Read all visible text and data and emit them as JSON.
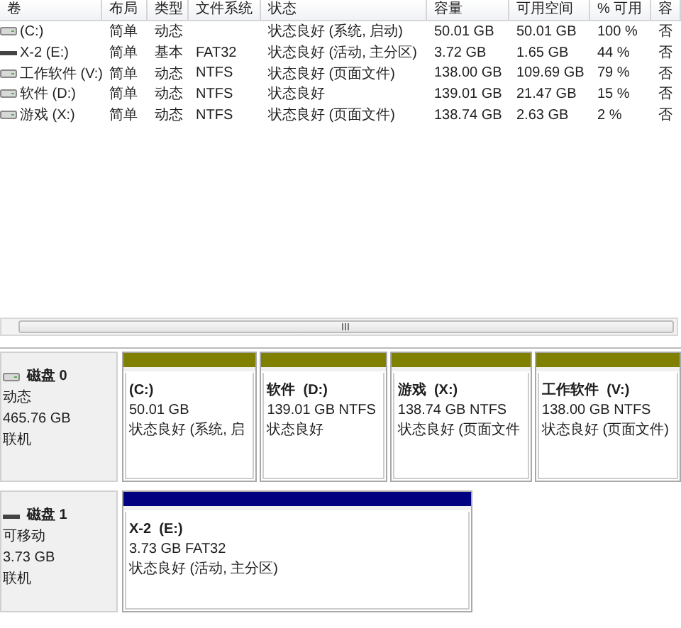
{
  "volume_table": {
    "columns": [
      "卷",
      "布局",
      "类型",
      "文件系统",
      "状态",
      "容量",
      "可用空间",
      "% 可用",
      "容"
    ],
    "rows": [
      {
        "removable": false,
        "cells": [
          "(C:)",
          "简单",
          "动态",
          "",
          "状态良好 (系统, 启动)",
          "50.01 GB",
          "50.01 GB",
          "100 %",
          "否"
        ]
      },
      {
        "removable": true,
        "cells": [
          "X-2 (E:)",
          "简单",
          "基本",
          "FAT32",
          "状态良好 (活动, 主分区)",
          "3.72 GB",
          "1.65 GB",
          "44 %",
          "否"
        ]
      },
      {
        "removable": false,
        "cells": [
          "工作软件 (V:)",
          "简单",
          "动态",
          "NTFS",
          "状态良好 (页面文件)",
          "138.00 GB",
          "109.69 GB",
          "79 %",
          "否"
        ]
      },
      {
        "removable": false,
        "cells": [
          "软件 (D:)",
          "简单",
          "动态",
          "NTFS",
          "状态良好",
          "139.01 GB",
          "21.47 GB",
          "15 %",
          "否"
        ]
      },
      {
        "removable": false,
        "cells": [
          "游戏 (X:)",
          "简单",
          "动态",
          "NTFS",
          "状态良好 (页面文件)",
          "138.74 GB",
          "2.63 GB",
          "2 %",
          "否"
        ]
      }
    ]
  },
  "disks": [
    {
      "removable": false,
      "name": "磁盘 0",
      "type": "动态",
      "size": "465.76 GB",
      "status": "联机",
      "partitions": [
        {
          "label": "(C:)",
          "size_fs": "50.01 GB",
          "status": "状态良好 (系统, 启",
          "color": "#808000"
        },
        {
          "label": "软件  (D:)",
          "size_fs": "139.01 GB NTFS",
          "status": "状态良好",
          "color": "#808000"
        },
        {
          "label": "游戏  (X:)",
          "size_fs": "138.74 GB NTFS",
          "status": "状态良好 (页面文件",
          "color": "#808000"
        },
        {
          "label": "工作软件  (V:)",
          "size_fs": "138.00 GB NTFS",
          "status": "状态良好 (页面文件)",
          "color": "#808000"
        }
      ]
    },
    {
      "removable": true,
      "name": "磁盘 1",
      "type": "可移动",
      "size": "3.73 GB",
      "status": "联机",
      "partitions": [
        {
          "label": "X-2  (E:)",
          "size_fs": "3.73 GB FAT32",
          "status": "状态良好 (活动, 主分区)",
          "color": "#000080"
        }
      ]
    }
  ]
}
